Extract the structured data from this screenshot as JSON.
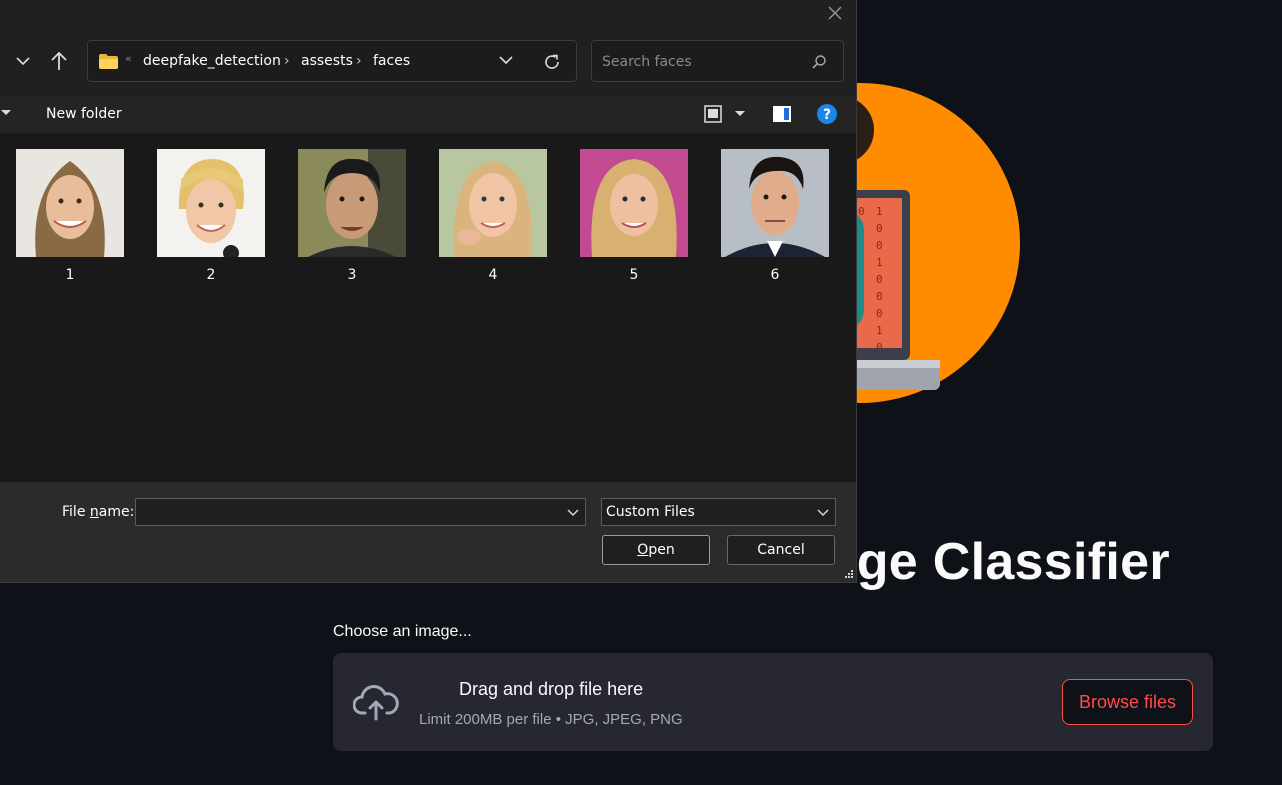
{
  "app": {
    "title": "Real vs. Fake Image Classifier",
    "uploader_label": "Choose an image...",
    "dropzone_main": "Drag and drop file here",
    "dropzone_sub": "Limit 200MB per file • JPG, JPEG, PNG",
    "browse_label": "Browse files",
    "accent_color": "#ff4b4b"
  },
  "dialog": {
    "breadcrumb": [
      "deepfake_detection",
      "assests",
      "faces"
    ],
    "search_placeholder": "Search faces",
    "new_folder_label": "New folder",
    "files": [
      {
        "name": "1"
      },
      {
        "name": "2"
      },
      {
        "name": "3"
      },
      {
        "name": "4"
      },
      {
        "name": "5"
      },
      {
        "name": "6"
      }
    ],
    "file_name_label_pre": "File ",
    "file_name_label_accel": "n",
    "file_name_label_post": "ame:",
    "file_name_value": "",
    "file_type_value": "Custom Files",
    "open_accel": "O",
    "open_rest": "pen",
    "cancel_label": "Cancel"
  }
}
